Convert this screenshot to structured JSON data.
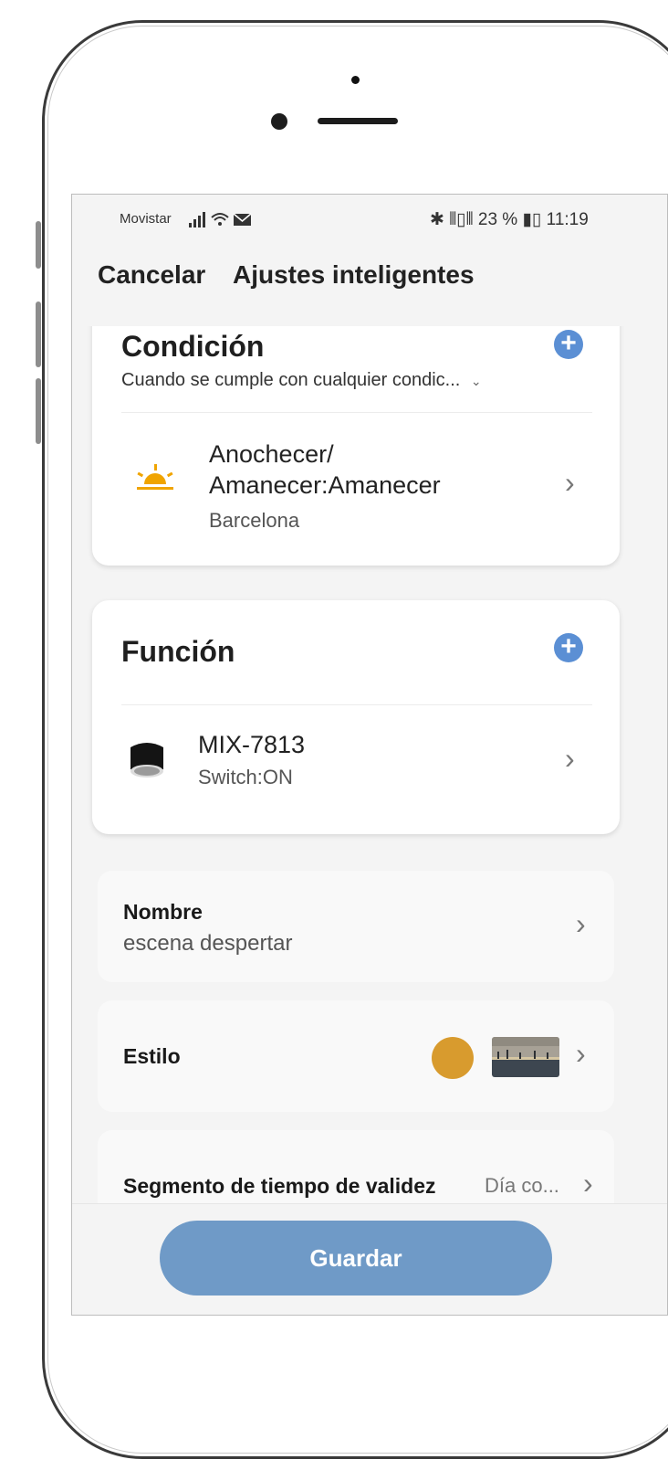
{
  "status_bar": {
    "carrier": "Movistar",
    "right": "✱ ⫴▯⫴ 23 % ▮▯ 11:19"
  },
  "nav": {
    "cancel_label": "Cancelar",
    "title": "Ajustes inteligentes"
  },
  "condition": {
    "title": "Condición",
    "mode": "Cuando se cumple con cualquier condic...",
    "item": {
      "title_line1": "Anochecer/",
      "title_line2": "Amanecer:Amanecer",
      "location": "Barcelona",
      "icon": "sunrise-icon"
    }
  },
  "function": {
    "title": "Función",
    "item": {
      "device": "MIX-7813",
      "action": "Switch:ON",
      "icon": "downlight-icon"
    }
  },
  "name_row": {
    "label": "Nombre",
    "value": "escena despertar"
  },
  "style_row": {
    "label": "Estilo",
    "color": "#d89b2e"
  },
  "validity_row": {
    "label": "Segmento de tiempo de validez",
    "value": "Día co..."
  },
  "save_label": "Guardar",
  "colors": {
    "accent": "#5b8fd4",
    "save_button": "#6f9ac7",
    "sun": "#f0a400"
  }
}
